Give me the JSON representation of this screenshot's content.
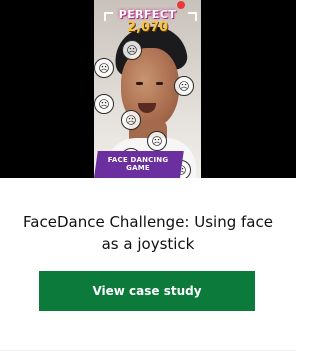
{
  "card": {
    "title": "FaceDance Challenge: Using face as a joystick",
    "cta_label": "View case study"
  },
  "video": {
    "perfect_text": "PERFECT",
    "score": "2,070",
    "game_label": "FACE DANCING GAME"
  },
  "icons": {
    "emoji_sad": "☹",
    "emoji_happy": "☺"
  },
  "colors": {
    "cta_background": "#0b7a3b",
    "game_label_background": "#6b2fa0"
  }
}
